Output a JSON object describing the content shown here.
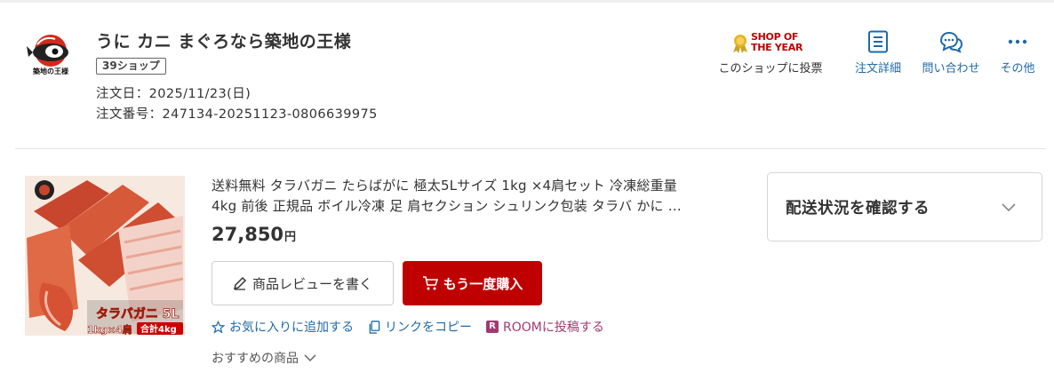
{
  "shop": {
    "name": "うに カニ まぐろなら築地の王様",
    "badge": "39ショップ",
    "order_date": "注文日：2025/11/23(日)",
    "order_number": "注文番号：247134-20251123-0806639975"
  },
  "actions": {
    "shop_of_year_line1": "SHOP OF",
    "shop_of_year_line2": "THE YEAR",
    "vote_label": "このショップに投票",
    "order_detail_label": "注文詳細",
    "contact_label": "問い合わせ",
    "more_label": "その他"
  },
  "product": {
    "title_line1": "送料無料 タラバガニ たらばがに 極太5Lサイズ 1kg ×4肩セット 冷凍総重量",
    "title_line2": "4kg 前後 正規品 ボイル冷凍 足 肩セクション シュリンク包装 タラバ かに …",
    "price": "27,850",
    "price_unit": "円",
    "image_text_1": "タラバガニ 5L",
    "image_text_2": "1kg×4肩",
    "image_text_3": "合計4kg",
    "review_button": "商品レビューを書く",
    "rebuy_button": "もう一度購入",
    "favorite_link": "お気に入りに追加する",
    "copy_link": "リンクをコピー",
    "room_badge": "R",
    "room_link": "ROOMに投稿する",
    "recommend_link": "おすすめの商品"
  },
  "delivery": {
    "label": "配送状況を確認する"
  },
  "colors": {
    "brand_red": "#bf0000",
    "link_blue": "#1e6aa8",
    "room_purple": "#a23a71"
  }
}
